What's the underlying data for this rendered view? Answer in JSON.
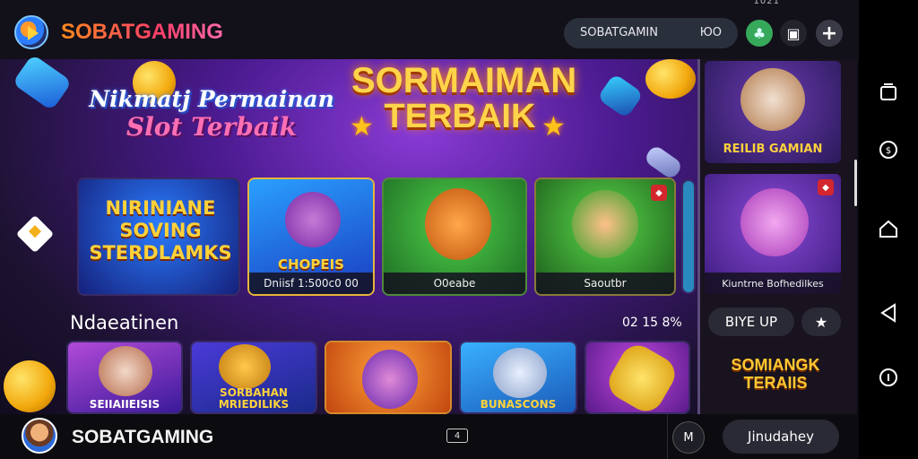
{
  "status_bar": {
    "right_text": "1021"
  },
  "header": {
    "brand": "SOBATGAMING",
    "account_name": "SOBATGAMIN",
    "balance": "ЮО",
    "buttons": {
      "green_icon": "clover-icon",
      "wallet_icon": "wallet-icon",
      "add_icon": "plus-icon"
    }
  },
  "hero": {
    "left_line1": "Nikmatj Permainan",
    "left_line2": "Slot Terbaik",
    "title_line1": "SORMAIMAN",
    "title_line2": "TERBAIK"
  },
  "featured_games": [
    {
      "title": "NIRINIANE SOVING STERDLAMKS",
      "caption": ""
    },
    {
      "title": "CHOPEIS",
      "caption": "Dniisf  1:500c0   00"
    },
    {
      "title": "",
      "caption": "O0eabe"
    },
    {
      "title": "",
      "caption": "Saoutbr"
    }
  ],
  "section": {
    "title": "Ndaeatinen",
    "meta": "02  15  8%"
  },
  "bottom_games": [
    {
      "title": "SEIIAIIEISIS"
    },
    {
      "title": "SORBAHAN MRIEDILIKS"
    },
    {
      "title": ""
    },
    {
      "title": "BUNASCONS"
    },
    {
      "title": ""
    }
  ],
  "right_panel": {
    "top_card_title": "REILIB GAMIAN",
    "second_card_caption": "Kiuntrne Bofhedilkes",
    "pill_label": "BIYE UP",
    "star_label": "★",
    "promo_line1": "SOMIANGK",
    "promo_line2": "TERAIIS"
  },
  "bottom_bar": {
    "brand": "SOBATGAMING",
    "mid_icon_text": "4",
    "circle_label": "M",
    "button_label": "Jinudahey"
  },
  "android_nav": [
    "recents-icon",
    "coin-icon",
    "home-icon",
    "back-icon",
    "info-icon"
  ]
}
